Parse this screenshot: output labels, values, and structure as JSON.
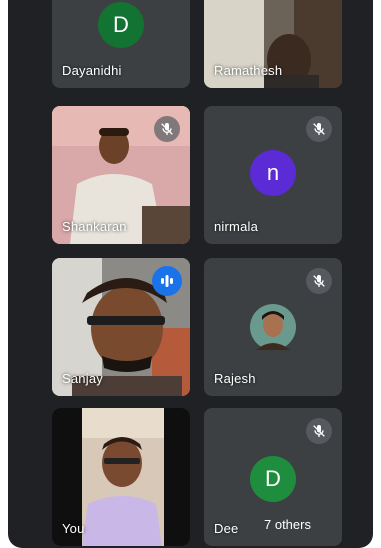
{
  "participants": [
    {
      "name": "Dayanidhi",
      "avatar_letter": "D",
      "avatar_color": "#137333",
      "muted": false
    },
    {
      "name": "Ramathesh",
      "muted": false
    },
    {
      "name": "Shankaran",
      "muted": true
    },
    {
      "name": "nirmala",
      "avatar_letter": "n",
      "avatar_color": "#5b2bd6",
      "muted": true
    },
    {
      "name": "Sanjay",
      "speaking": true
    },
    {
      "name": "Rajesh",
      "muted": true
    },
    {
      "name": "You"
    },
    {
      "name": "Dee",
      "avatar_letter": "D",
      "avatar_color": "#1e8e3e",
      "muted": true
    }
  ],
  "others_label": "7 others",
  "icons": {
    "mute": "mic-off-icon",
    "speaking": "audio-level-icon"
  }
}
